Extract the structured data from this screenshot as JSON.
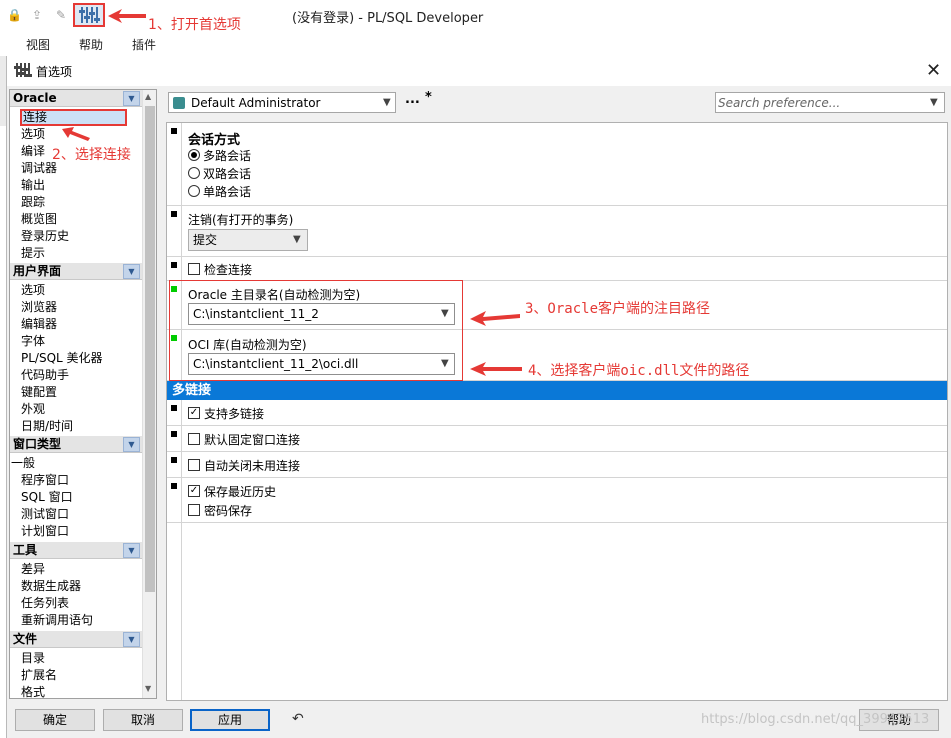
{
  "app": {
    "title": "(没有登录) - PL/SQL Developer",
    "menu": [
      "视图",
      "帮助",
      "插件"
    ]
  },
  "annotations": {
    "step1": "1、打开首选项",
    "step2": "2、选择连接",
    "step3": "3、Oracle客户端的注目路径",
    "step4": "4、选择客户端oic.dll文件的路径",
    "color": "#e53935"
  },
  "dialog": {
    "title": "首选项",
    "profile": "Default Administrator",
    "profile_extra": "...",
    "profile_modified": "*",
    "search_placeholder": "Search preference...",
    "tree": {
      "groups": [
        {
          "name": "Oracle",
          "items": [
            "连接",
            "选项",
            "编译",
            "调试器",
            "输出",
            "跟踪",
            "概览图",
            "登录历史",
            "提示"
          ]
        },
        {
          "name": "用户界面",
          "items": [
            "选项",
            "浏览器",
            "编辑器",
            "字体",
            "PL/SQL 美化器",
            "代码助手",
            "键配置",
            "外观",
            "日期/时间"
          ]
        },
        {
          "name": "窗口类型",
          "items": [
            "一般",
            "程序窗口",
            "SQL 窗口",
            "测试窗口",
            "计划窗口"
          ]
        },
        {
          "name": "工具",
          "items": [
            "差异",
            "数据生成器",
            "任务列表",
            "重新调用语句"
          ]
        },
        {
          "name": "文件",
          "items": [
            "目录",
            "扩展名",
            "格式"
          ]
        }
      ],
      "selected": "连接"
    },
    "settings": {
      "session_mode": {
        "label": "会话方式",
        "options": [
          "多路会话",
          "双路会话",
          "单路会话"
        ],
        "selected": "多路会话"
      },
      "logoff": {
        "label": "注销(有打开的事务)",
        "value": "提交"
      },
      "check_connection": {
        "label": "检查连接",
        "checked": false
      },
      "oracle_home": {
        "label": "Oracle 主目录名(自动检测为空)",
        "value": "C:\\instantclient_11_2"
      },
      "oci_library": {
        "label": "OCI 库(自动检测为空)",
        "value": "C:\\instantclient_11_2\\oci.dll"
      },
      "multi_connection_section": "多链接",
      "multi_support": {
        "label": "支持多链接",
        "checked": true
      },
      "default_fixed": {
        "label": "默认固定窗口连接",
        "checked": false
      },
      "auto_close": {
        "label": "自动关闭未用连接",
        "checked": false
      },
      "save_history": {
        "label": "保存最近历史",
        "checked": true
      },
      "save_password": {
        "label": "密码保存",
        "checked": false
      }
    },
    "buttons": {
      "ok": "确定",
      "cancel": "取消",
      "apply": "应用",
      "help": "帮助"
    },
    "watermark": "https://blog.csdn.net/qq_39947513"
  }
}
